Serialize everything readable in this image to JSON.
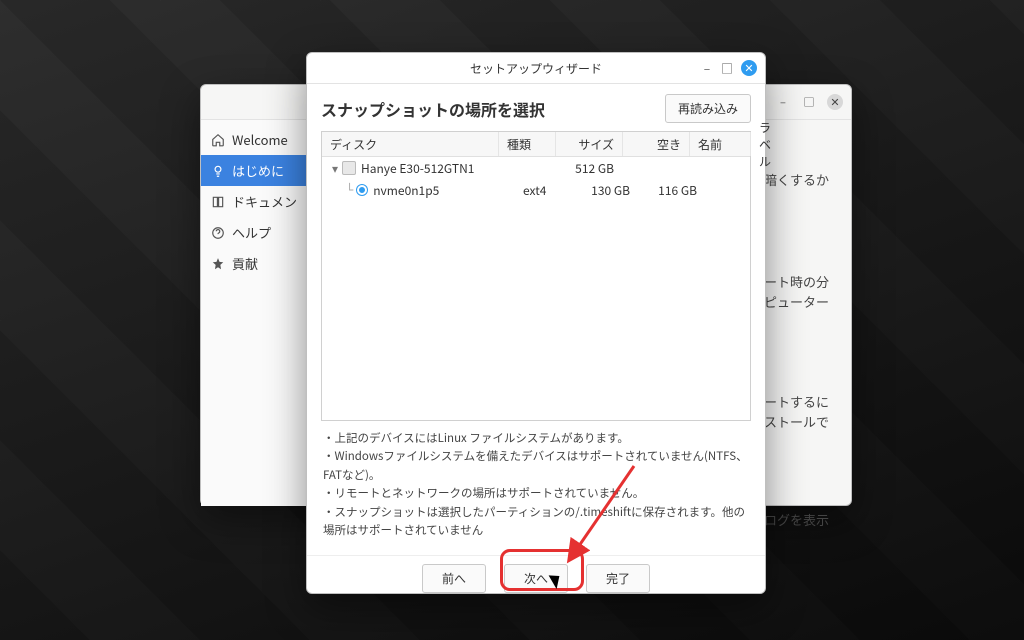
{
  "desktop": {},
  "backWindow": {
    "sidebar": {
      "items": [
        {
          "icon": "home",
          "label": "Welcome"
        },
        {
          "icon": "bulb",
          "label": "はじめに"
        },
        {
          "icon": "book",
          "label": "ドキュメン"
        },
        {
          "icon": "help",
          "label": "ヘルプ"
        },
        {
          "icon": "star",
          "label": "貢献"
        }
      ],
      "activeIndex": 1
    },
    "peekText": {
      "l1": "暗くするか",
      "l2a": "ブート時の分",
      "l2b": "ンピューター",
      "l3a": "ートするに",
      "l3b": "ンストールで",
      "l4": "イアログを表示"
    }
  },
  "dialog": {
    "title": "セットアップウィザード",
    "heading": "スナップショットの場所を選択",
    "reload": "再読み込み",
    "columns": {
      "disk": "ディスク",
      "type": "種類",
      "size": "サイズ",
      "free": "空き",
      "name": "名前",
      "label": "ラベル"
    },
    "rows": [
      {
        "kind": "disk",
        "name": "Hanye E30-512GTN1",
        "type": "",
        "size": "512 GB",
        "free": ""
      },
      {
        "kind": "part",
        "name": "nvme0n1p5",
        "type": "ext4",
        "size": "130 GB",
        "free": "116 GB"
      }
    ],
    "notes": [
      "上記のデバイスにはLinux ファイルシステムがあります。",
      "Windowsファイルシステムを備えたデバイスはサポートされていません(NTFS、FATなど)。",
      "リモートとネットワークの場所はサポートされていません。",
      "スナップショットは選択したパーティションの/.timeshiftに保存されます。他の場所はサポートされていません"
    ],
    "buttons": {
      "prev": "前へ",
      "next": "次へ",
      "finish": "完了"
    }
  }
}
